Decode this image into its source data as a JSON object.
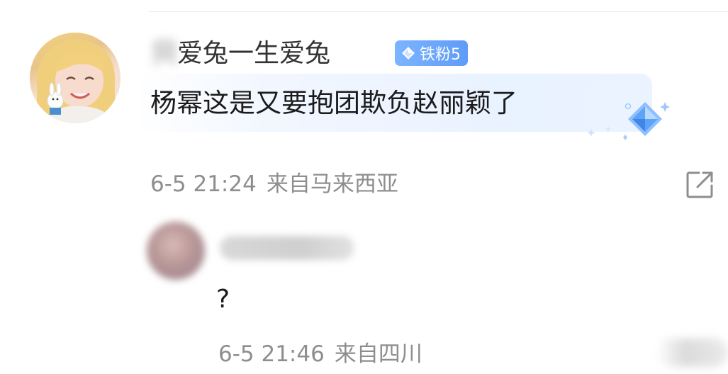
{
  "comments": [
    {
      "username": "只爱兔一生爱兔",
      "username_visible": "爱兔一生爱兔",
      "username_blurred": "只",
      "badge": {
        "label": "铁粉5",
        "icon": "diamond-icon",
        "color": "#6aa6fb"
      },
      "text": "杨幂这是又要抱团欺负赵丽颖了",
      "timestamp": "6-5 21:24",
      "location": "来自马来西亚",
      "share_icon": "share-external-icon"
    },
    {
      "text": "?",
      "timestamp": "6-5 21:46",
      "location": "来自四川"
    }
  ],
  "colors": {
    "meta_text": "#8e8e8e",
    "bubble": "#e9f2ff",
    "badge": "#6aa6fb"
  }
}
